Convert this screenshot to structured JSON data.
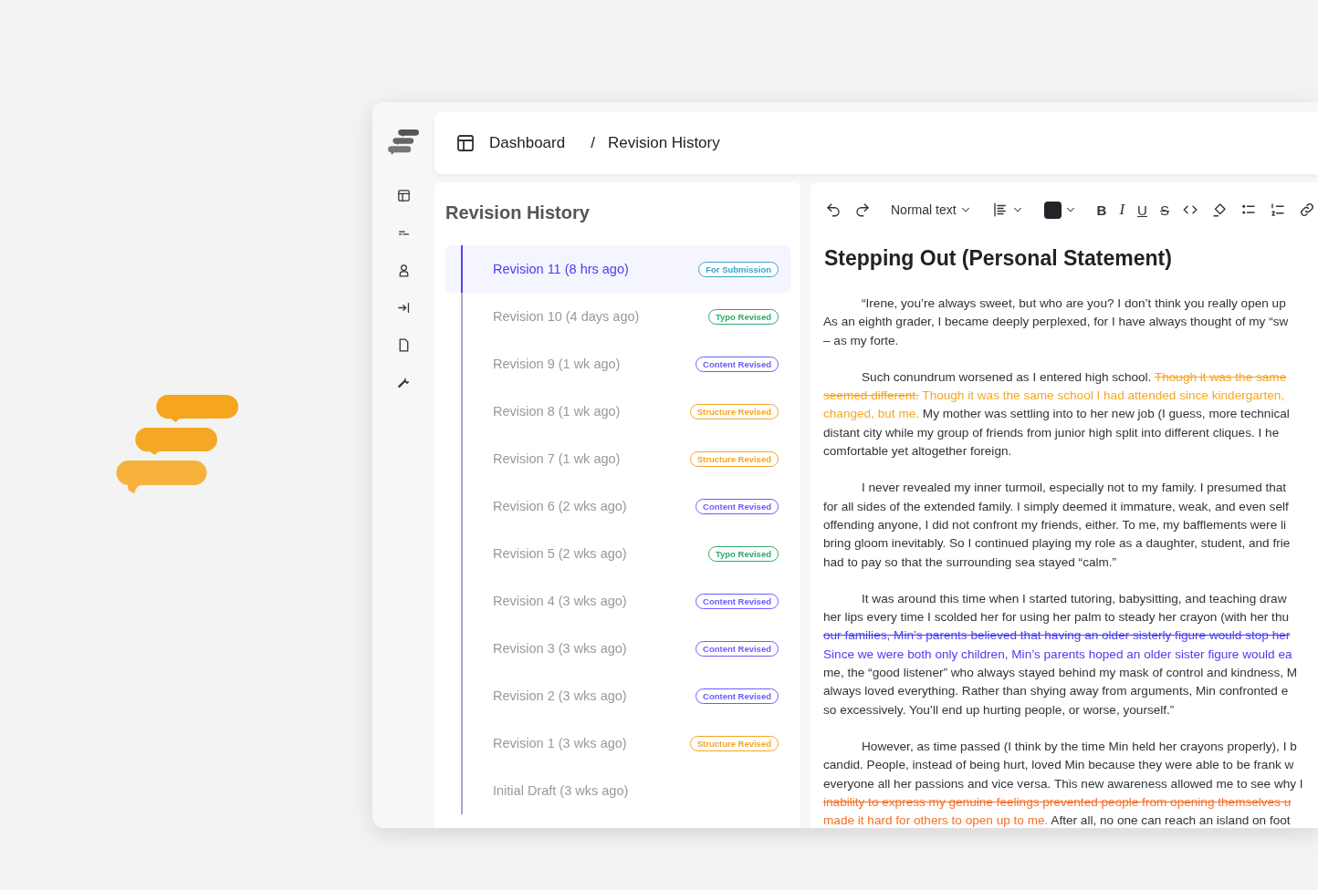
{
  "breadcrumb": {
    "items": [
      "Dashboard",
      "Revision History"
    ],
    "separator": "/"
  },
  "sidebar": {
    "items": [
      {
        "kind": "layout"
      },
      {
        "kind": "lines"
      },
      {
        "kind": "person"
      },
      {
        "kind": "arrow"
      },
      {
        "kind": "document"
      },
      {
        "kind": "wrench"
      }
    ]
  },
  "revisions": {
    "title": "Revision History",
    "items": [
      {
        "label": "Revision 11 (8 hrs ago)",
        "selected": true,
        "tag": "For Submission",
        "color": "#3ba3c4"
      },
      {
        "label": "Revision 10 (4 days ago)",
        "selected": false,
        "tag": "Typo Revised",
        "color": "#2ea86b"
      },
      {
        "label": "Revision 9 (1 wk ago)",
        "selected": false,
        "tag": "Content Revised",
        "color": "#6a5cff"
      },
      {
        "label": "Revision 8 (1 wk ago)",
        "selected": false,
        "tag": "Structure Revised",
        "color": "#f5a623"
      },
      {
        "label": "Revision 7 (1 wk ago)",
        "selected": false,
        "tag": "Structure Revised",
        "color": "#f5a623"
      },
      {
        "label": "Revision 6 (2 wks ago)",
        "selected": false,
        "tag": "Content Revised",
        "color": "#6a5cff"
      },
      {
        "label": "Revision 5 (2 wks ago)",
        "selected": false,
        "tag": "Typo Revised",
        "color": "#2ea86b"
      },
      {
        "label": "Revision 4 (3 wks ago)",
        "selected": false,
        "tag": "Content Revised",
        "color": "#6a5cff"
      },
      {
        "label": "Revision 3 (3 wks ago)",
        "selected": false,
        "tag": "Content Revised",
        "color": "#6a5cff"
      },
      {
        "label": "Revision 2 (3 wks ago)",
        "selected": false,
        "tag": "Content Revised",
        "color": "#6a5cff"
      },
      {
        "label": "Revision 1 (3 wks ago)",
        "selected": false,
        "tag": "Structure Revised",
        "color": "#f5a623"
      },
      {
        "label": "Initial Draft (3 wks ago)",
        "selected": false
      }
    ]
  },
  "toolbar": [
    {
      "kind": "undo"
    },
    {
      "kind": "redo"
    },
    {
      "kind": "dropdown",
      "label": "Normal text"
    },
    {
      "kind": "align"
    },
    {
      "kind": "color",
      "color": "#212529"
    },
    {
      "kind": "bold",
      "label": "B"
    },
    {
      "kind": "italic",
      "label": "I"
    },
    {
      "kind": "underline",
      "label": "U"
    },
    {
      "kind": "strike",
      "label": "S"
    },
    {
      "kind": "code"
    },
    {
      "kind": "clear"
    },
    {
      "kind": "bullets"
    },
    {
      "kind": "numbers"
    },
    {
      "kind": "link"
    }
  ],
  "document": {
    "title": "Stepping Out (Personal Statement)",
    "paragraphs": [
      [
        [
          {
            "kind": "normal",
            "text": "“Irene, you’re always sweet, but who are you? I don’t think you really open up"
          }
        ],
        [
          {
            "kind": "normal",
            "text": "As an eighth grader, I became deeply perplexed, for I have always thought of my “sw"
          }
        ],
        [
          {
            "kind": "normal",
            "text": "– as my forte."
          }
        ]
      ],
      [
        [
          {
            "kind": "normal",
            "text": "Such conundrum worsened as I entered high school. "
          },
          {
            "kind": "deleted",
            "text": "Though it was the same",
            "color": "#f5a623"
          }
        ],
        [
          {
            "kind": "deleted",
            "text": "seemed different.",
            "color": "#f5a623"
          },
          {
            "kind": "inserted",
            "text": " Though it was the same school I had attended since kindergarten,",
            "color": "#f5a623"
          }
        ],
        [
          {
            "kind": "inserted",
            "text": "changed, but me.",
            "color": "#f5a623"
          },
          {
            "kind": "normal",
            "text": " My mother was settling into to her new job (I guess, more technical"
          }
        ],
        [
          {
            "kind": "normal",
            "text": "distant city while my group of friends from junior high split into different cliques. I he"
          }
        ],
        [
          {
            "kind": "normal",
            "text": "comfortable yet altogether foreign."
          }
        ]
      ],
      [
        [
          {
            "kind": "normal",
            "text": "I never revealed my inner turmoil, especially not to my family. I presumed that"
          }
        ],
        [
          {
            "kind": "normal",
            "text": "for all sides of the extended family. I simply deemed it immature, weak, and even self"
          }
        ],
        [
          {
            "kind": "normal",
            "text": "offending anyone, I did not confront my friends, either. To me, my bafflements were li"
          }
        ],
        [
          {
            "kind": "normal",
            "text": "bring gloom inevitably. So I continued playing my role as a daughter, student, and frie"
          }
        ],
        [
          {
            "kind": "normal",
            "text": "had to pay so that the surrounding sea stayed “calm.”"
          }
        ]
      ],
      [
        [
          {
            "kind": "normal",
            "text": "It was around this time when I started tutoring, babysitting, and teaching draw"
          }
        ],
        [
          {
            "kind": "normal",
            "text": "her lips every time I scolded her for using her palm to steady her crayon (with her thu"
          }
        ],
        [
          {
            "kind": "deleted",
            "text": "our families, Min’s parents believed that having an older sisterly figure would stop her",
            "color": "#4b3cf0"
          }
        ],
        [
          {
            "kind": "inserted",
            "text": "Since we were both only children, Min’s parents hoped an older sister figure would ea",
            "color": "#4b3cf0"
          }
        ],
        [
          {
            "kind": "normal",
            "text": "me, the “good listener” who always stayed behind my mask of control and kindness, M"
          }
        ],
        [
          {
            "kind": "normal",
            "text": "always loved everything. Rather than shying away from arguments, Min confronted e"
          }
        ],
        [
          {
            "kind": "normal",
            "text": "so excessively. You’ll end up hurting people, or worse, yourself.”"
          }
        ]
      ],
      [
        [
          {
            "kind": "normal",
            "text": "However, as time passed (I think by the time Min held her crayons properly), I b"
          }
        ],
        [
          {
            "kind": "normal",
            "text": "candid. People, instead of being hurt, loved Min because they were able to be frank w"
          }
        ],
        [
          {
            "kind": "normal",
            "text": "everyone all her passions and vice versa. This new awareness allowed me to see why I"
          }
        ],
        [
          {
            "kind": "deleted",
            "text": "inability to express my genuine feelings prevented people from opening themselves u",
            "color": "#f5702a"
          }
        ],
        [
          {
            "kind": "inserted",
            "text": "made it hard for others to open up to me.",
            "color": "#f5702a"
          },
          {
            "kind": "normal",
            "text": " After all, no one can reach an island on foot"
          }
        ]
      ]
    ]
  }
}
